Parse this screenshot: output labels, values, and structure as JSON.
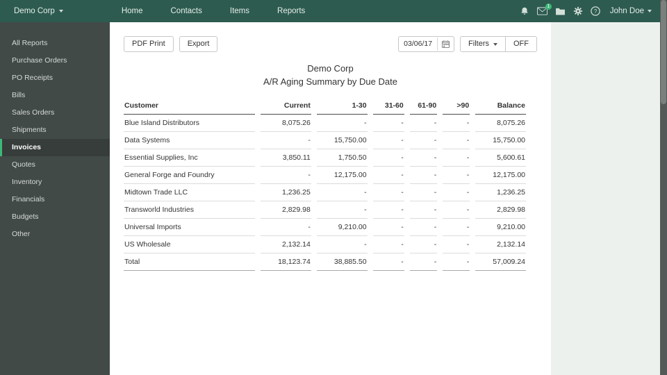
{
  "navbar": {
    "company": "Demo Corp",
    "items": [
      "Home",
      "Contacts",
      "Items",
      "Reports"
    ],
    "mail_badge": "1",
    "help_glyph": "?",
    "user": "John Doe"
  },
  "sidebar": {
    "items": [
      {
        "label": "All Reports",
        "active": false
      },
      {
        "label": "Purchase Orders",
        "active": false
      },
      {
        "label": "PO Receipts",
        "active": false
      },
      {
        "label": "Bills",
        "active": false
      },
      {
        "label": "Sales Orders",
        "active": false
      },
      {
        "label": "Shipments",
        "active": false
      },
      {
        "label": "Invoices",
        "active": true
      },
      {
        "label": "Quotes",
        "active": false
      },
      {
        "label": "Inventory",
        "active": false
      },
      {
        "label": "Financials",
        "active": false
      },
      {
        "label": "Budgets",
        "active": false
      },
      {
        "label": "Other",
        "active": false
      }
    ]
  },
  "toolbar": {
    "pdf_print_label": "PDF Print",
    "export_label": "Export",
    "date_value": "03/06/17",
    "filters_label": "Filters",
    "off_label": "OFF"
  },
  "report": {
    "company": "Demo Corp",
    "title": "A/R Aging Summary by Due Date"
  },
  "table": {
    "columns": [
      "Customer",
      "Current",
      "1-30",
      "31-60",
      "61-90",
      ">90",
      "Balance"
    ],
    "rows": [
      {
        "customer": "Blue Island Distributors",
        "values": [
          "8,075.26",
          "-",
          "-",
          "-",
          "-",
          "8,075.26"
        ]
      },
      {
        "customer": "Data Systems",
        "values": [
          "-",
          "15,750.00",
          "-",
          "-",
          "-",
          "15,750.00"
        ]
      },
      {
        "customer": "Essential Supplies, Inc",
        "values": [
          "3,850.11",
          "1,750.50",
          "-",
          "-",
          "-",
          "5,600.61"
        ]
      },
      {
        "customer": "General Forge and Foundry",
        "values": [
          "-",
          "12,175.00",
          "-",
          "-",
          "-",
          "12,175.00"
        ]
      },
      {
        "customer": "Midtown Trade LLC",
        "values": [
          "1,236.25",
          "-",
          "-",
          "-",
          "-",
          "1,236.25"
        ]
      },
      {
        "customer": "Transworld Industries",
        "values": [
          "2,829.98",
          "-",
          "-",
          "-",
          "-",
          "2,829.98"
        ]
      },
      {
        "customer": "Universal Imports",
        "values": [
          "-",
          "9,210.00",
          "-",
          "-",
          "-",
          "9,210.00"
        ]
      },
      {
        "customer": "US Wholesale",
        "values": [
          "2,132.14",
          "-",
          "-",
          "-",
          "-",
          "2,132.14"
        ]
      }
    ],
    "total_row": {
      "customer": "Total",
      "values": [
        "18,123.74",
        "38,885.50",
        "-",
        "-",
        "-",
        "57,009.24"
      ]
    }
  },
  "colors": {
    "navbar_bg": "#2d5b4f",
    "sidebar_bg": "#424a48",
    "active_accent": "#3eb878",
    "page_bg": "#edf1ee"
  }
}
